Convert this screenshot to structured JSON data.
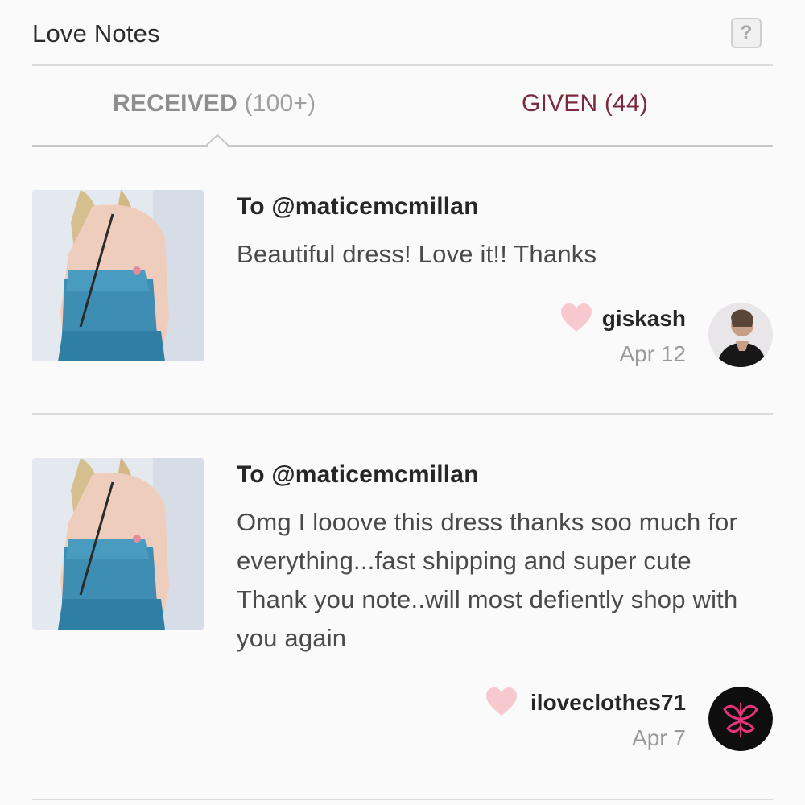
{
  "header": {
    "title": "Love Notes",
    "help_label": "?"
  },
  "tabs": {
    "received": {
      "label": "RECEIVED",
      "count": "(100+)"
    },
    "given": {
      "label": "GIVEN (44)"
    }
  },
  "notes": [
    {
      "to": "To @maticemcmillan",
      "message": "Beautiful dress! Love it!! Thanks",
      "giver": "giskash",
      "date": "Apr 12"
    },
    {
      "to": "To @maticemcmillan",
      "message": "Omg I looove this dress thanks soo much for everything...fast shipping and super cute Thank you note..will most defiently shop with you again",
      "giver": "iloveclothes71",
      "date": "Apr 7"
    }
  ],
  "colors": {
    "given_tab": "#7b2a3d",
    "heart": "#f7c9cf",
    "divider": "#dcdadc"
  }
}
